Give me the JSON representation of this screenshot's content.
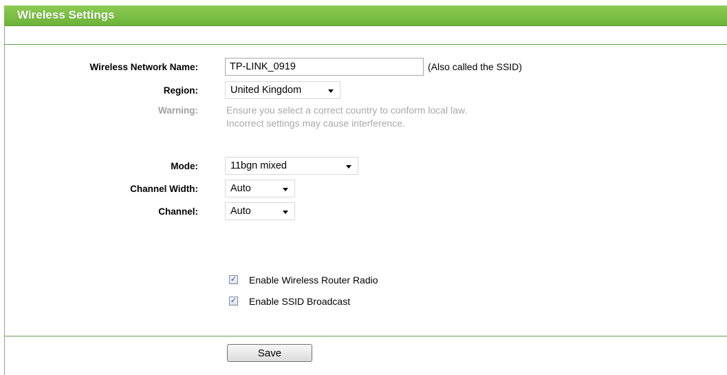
{
  "header": {
    "title": "Wireless Settings"
  },
  "ssid": {
    "label": "Wireless Network Name:",
    "value": "TP-LINK_0919",
    "note": "(Also called the SSID)"
  },
  "region": {
    "label": "Region:",
    "value": "United Kingdom"
  },
  "warning": {
    "label": "Warning:",
    "line1": "Ensure you select a correct country to conform local law.",
    "line2": "Incorrect settings may cause interference."
  },
  "mode": {
    "label": "Mode:",
    "value": "11bgn mixed"
  },
  "channel_width": {
    "label": "Channel Width:",
    "value": "Auto"
  },
  "channel": {
    "label": "Channel:",
    "value": "Auto"
  },
  "options": {
    "radio": {
      "label": "Enable Wireless Router Radio",
      "checked": true
    },
    "broadcast": {
      "label": "Enable SSID Broadcast",
      "checked": true
    }
  },
  "save_label": "Save",
  "colors": {
    "header": "#7cbe48",
    "divider": "#5ea24a",
    "warning": "#a8a8a8"
  }
}
